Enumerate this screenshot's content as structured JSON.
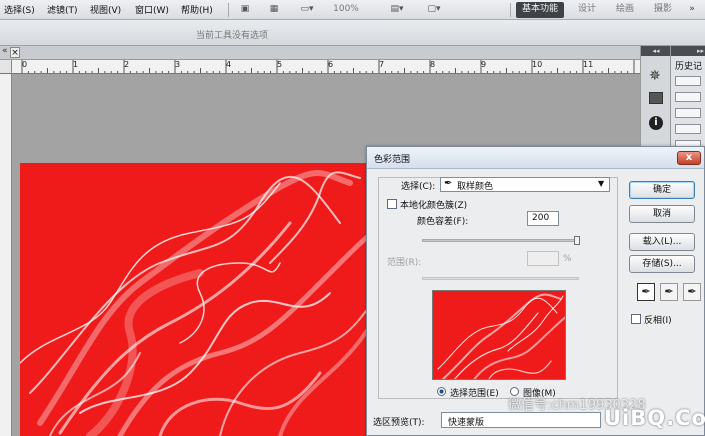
{
  "menubar": {
    "items": [
      "选择(S)",
      "滤镜(T)",
      "视图(V)",
      "窗口(W)",
      "帮助(H)"
    ],
    "zoom": "100%",
    "workspaces": [
      "基本功能",
      "设计",
      "绘画",
      "摄影"
    ],
    "more": "»"
  },
  "optionsbar": {
    "hint": "当前工具没有选项"
  },
  "doctab": {
    "close": "×"
  },
  "ruler": {
    "labels": [
      "0",
      "1",
      "2",
      "3",
      "4",
      "5",
      "6",
      "7",
      "8",
      "9",
      "10",
      "11"
    ]
  },
  "history": {
    "title": "历史记"
  },
  "dialog": {
    "title": "色彩范围",
    "close": "x",
    "select_label": "选择(C):",
    "select_value": "取样颜色",
    "localized_label": "本地化颜色簇(Z)",
    "fuzziness_label": "颜色容差(F):",
    "fuzziness_value": "200",
    "range_label": "范围(R):",
    "range_unit": "%",
    "radio_selection": "选择范围(E)",
    "radio_image": "图像(M)",
    "preview_label": "选区预览(T):",
    "preview_value": "快速蒙版",
    "buttons": {
      "ok": "确定",
      "cancel": "取消",
      "load": "载入(L)...",
      "save": "存储(S)..."
    },
    "invert_label": "反相(I)"
  },
  "watermark": {
    "text": "微信号:chm19930328",
    "brand": "UiBQ.CoM"
  },
  "colors": {
    "canvas_red": "#ef1b1b",
    "workspace_active": "#3f4247",
    "dialog_bg": "#ecedef"
  }
}
